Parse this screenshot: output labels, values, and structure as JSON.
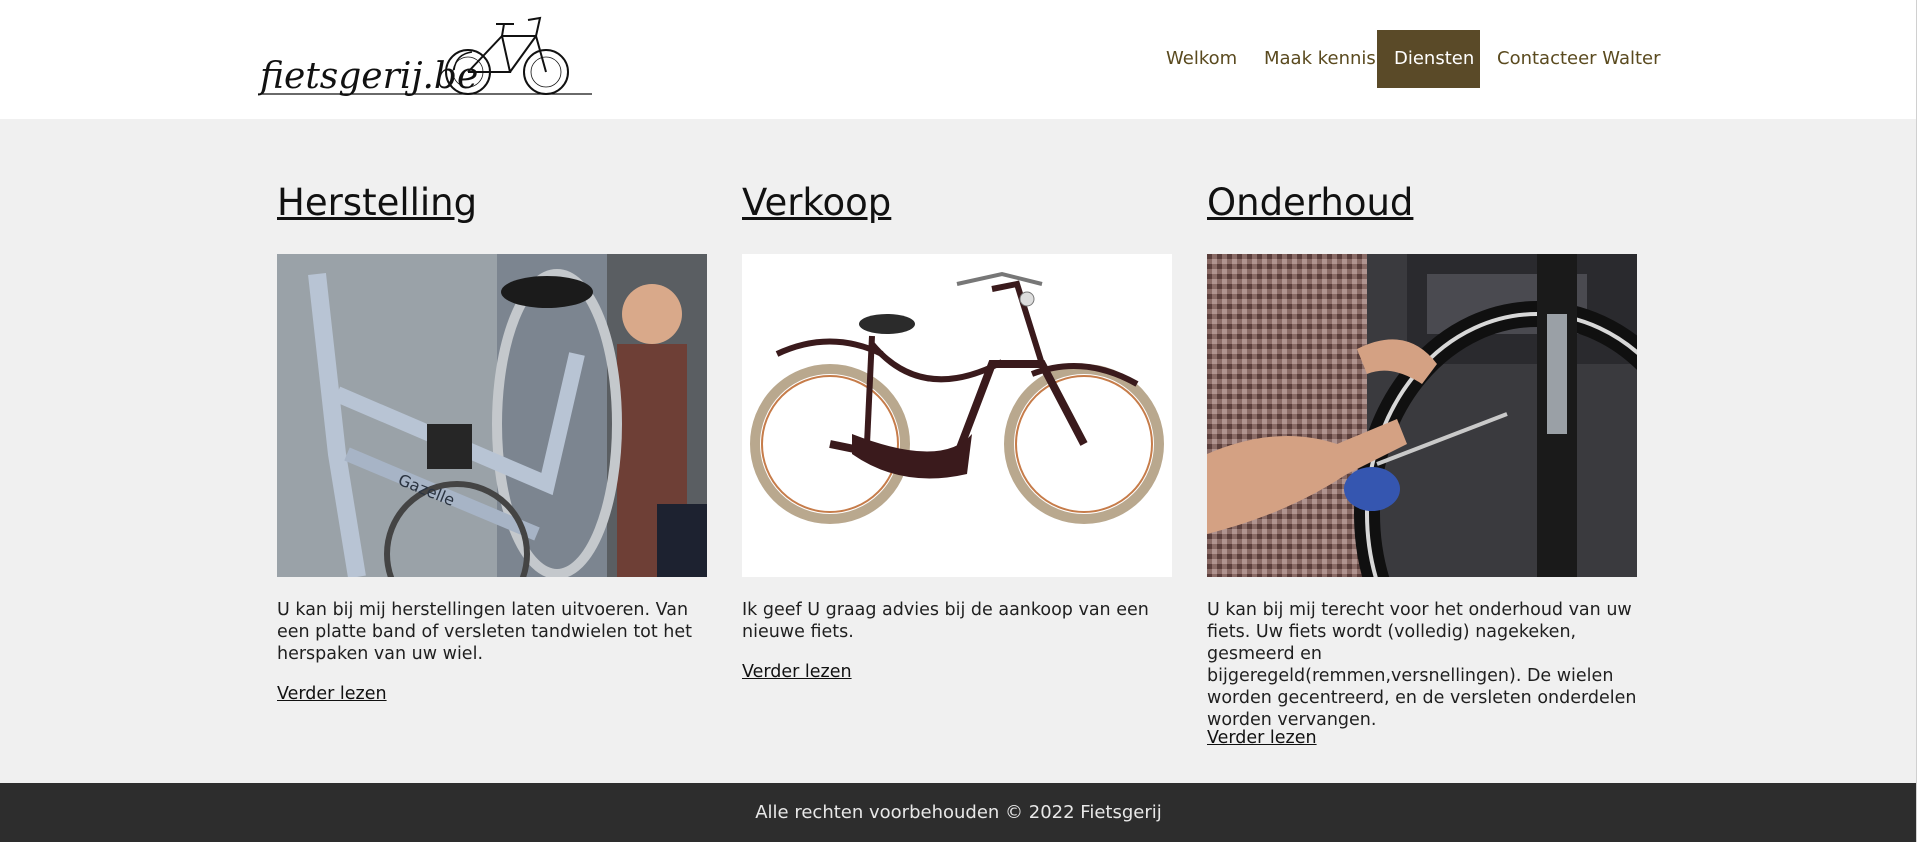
{
  "header": {
    "logo_text": "fietsgerij.be",
    "nav": [
      {
        "label": "Welkom",
        "active": false
      },
      {
        "label": "Maak kennis",
        "active": false
      },
      {
        "label": "Diensten",
        "active": true
      },
      {
        "label": "Contacteer Walter",
        "active": false
      }
    ]
  },
  "services": [
    {
      "title": "Herstelling",
      "image": "bike-repair-photo",
      "description": "U kan bij mij herstellingen laten uitvoeren. Van een platte band of versleten tandwielen tot het herspaken van uw wiel.",
      "link": "Verder lezen"
    },
    {
      "title": "Verkoop",
      "image": "bicycle-photo",
      "description": "Ik geef U graag advies bij de aankoop van een nieuwe fiets.",
      "link": "Verder lezen"
    },
    {
      "title": "Onderhoud",
      "image": "wheel-maintenance-photo",
      "description": "U kan bij mij terecht voor het onderhoud van uw fiets. Uw fiets wordt (volledig) nagekeken, gesmeerd en bijgeregeld(remmen,versnellingen). De wielen worden gecentreerd, en de versleten onderdelen worden vervangen.",
      "link": "Verder lezen"
    }
  ],
  "footer": {
    "text": "Alle rechten voorbehouden © 2022 Fietsgerij"
  },
  "colors": {
    "nav_text": "#5a4a1f",
    "nav_active_bg": "#5a4a28",
    "content_bg": "#f0f0f0",
    "footer_bg": "#2d2d2d"
  }
}
